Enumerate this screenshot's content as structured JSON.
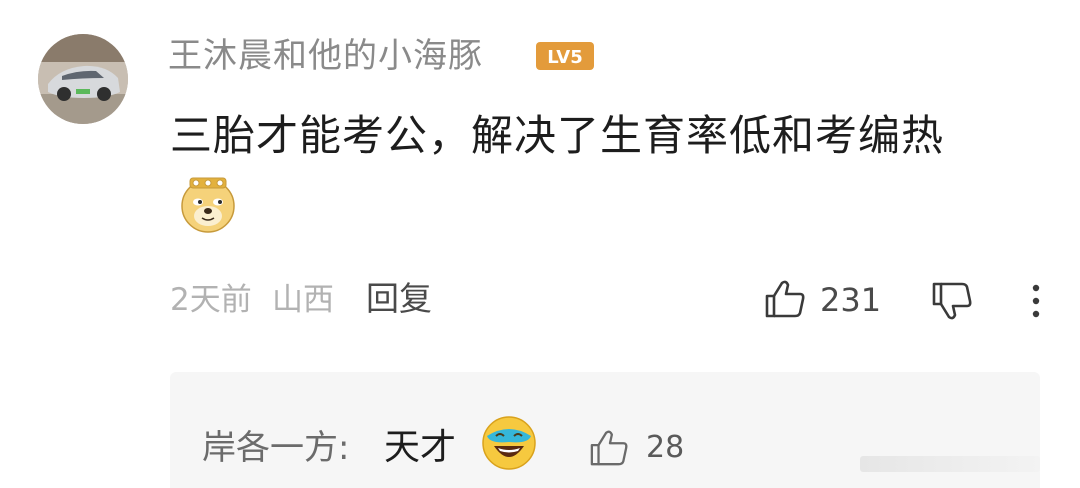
{
  "comment": {
    "username": "王沐晨和他的小海豚",
    "level_badge": "LV5",
    "text": "三胎才能考公，解决了生育率低和考编热",
    "emoji": "doge-emoji",
    "time": "2天前",
    "location": "山西",
    "reply_label": "回复",
    "like_count": "231"
  },
  "reply": {
    "user": "岸各一方:",
    "text": "天才",
    "emoji": "laugh-emoji",
    "like_count": "28"
  },
  "colors": {
    "level_badge": "#e39b3b",
    "doge_face": "#f5d27a",
    "username_text": "#8a8a8a",
    "reply_bg": "#f6f6f6"
  }
}
